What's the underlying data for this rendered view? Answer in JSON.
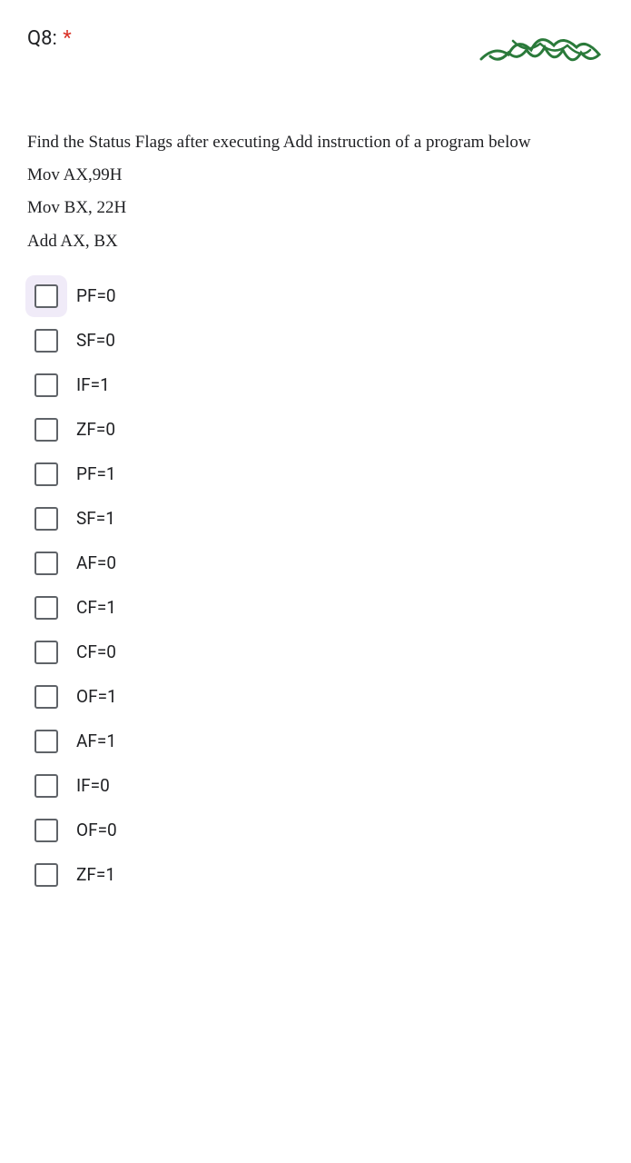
{
  "question": {
    "number": "Q8:",
    "required": "*",
    "prompt_line1": "Find the Status Flags after executing Add instruction of a program below",
    "prompt_line2": "Mov AX,99H",
    "prompt_line3": "Mov BX, 22H",
    "prompt_line4": "Add AX, BX"
  },
  "options": [
    {
      "label": "PF=0",
      "highlighted": true
    },
    {
      "label": "SF=0",
      "highlighted": false
    },
    {
      "label": "IF=1",
      "highlighted": false
    },
    {
      "label": "ZF=0",
      "highlighted": false
    },
    {
      "label": "PF=1",
      "highlighted": false
    },
    {
      "label": "SF=1",
      "highlighted": false
    },
    {
      "label": "AF=0",
      "highlighted": false
    },
    {
      "label": "CF=1",
      "highlighted": false
    },
    {
      "label": "CF=0",
      "highlighted": false
    },
    {
      "label": "OF=1",
      "highlighted": false
    },
    {
      "label": "AF=1",
      "highlighted": false
    },
    {
      "label": "IF=0",
      "highlighted": false
    },
    {
      "label": "OF=0",
      "highlighted": false
    },
    {
      "label": "ZF=1",
      "highlighted": false
    }
  ]
}
